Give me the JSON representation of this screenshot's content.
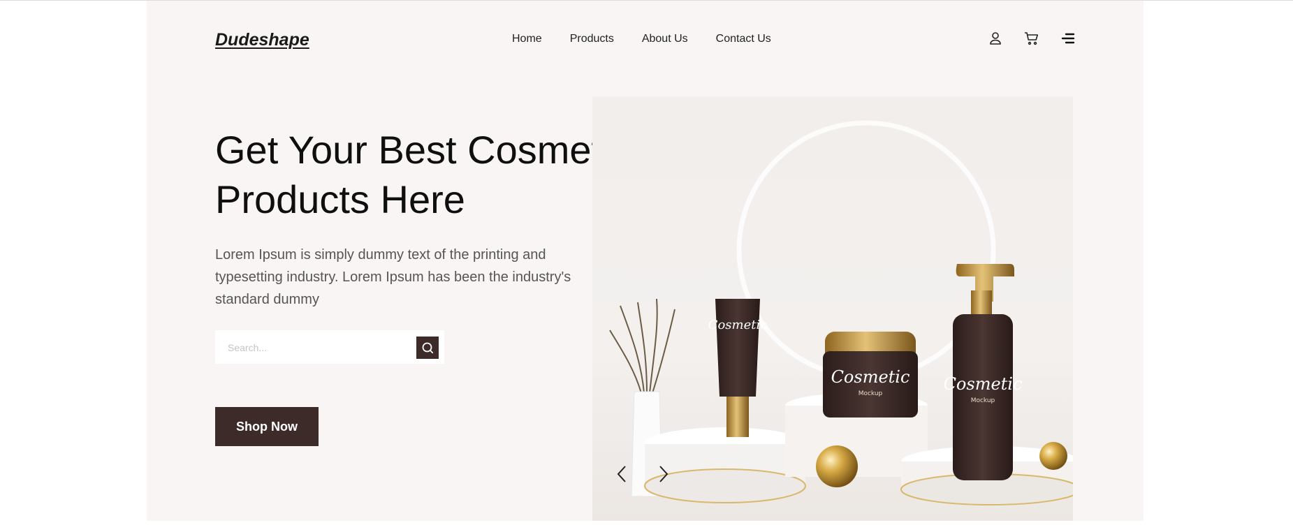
{
  "brand": {
    "logo": "Dudeshape"
  },
  "nav": {
    "items": [
      "Home",
      "Products",
      "About Us",
      "Contact Us"
    ]
  },
  "header_icons": [
    "user-icon",
    "cart-icon",
    "menu-icon"
  ],
  "hero": {
    "title_line1": "Get Your Best Cosmetic",
    "title_line2": "Products Here",
    "description": "Lorem Ipsum is simply dummy text of the printing and typesetting industry. Lorem Ipsum has been the industry's standard dummy",
    "search_placeholder": "Search...",
    "cta": "Shop Now"
  },
  "product_labels": {
    "tube": "Cosmetic",
    "jar": "Cosmetic",
    "bottle": "Cosmetic",
    "sub": "Mockup"
  },
  "slider": {
    "prev_icon": "chevron-left-icon",
    "next_icon": "chevron-right-icon"
  },
  "colors": {
    "accent": "#3d2b29",
    "background": "#f8f5f4",
    "gold": "#b98d33"
  }
}
